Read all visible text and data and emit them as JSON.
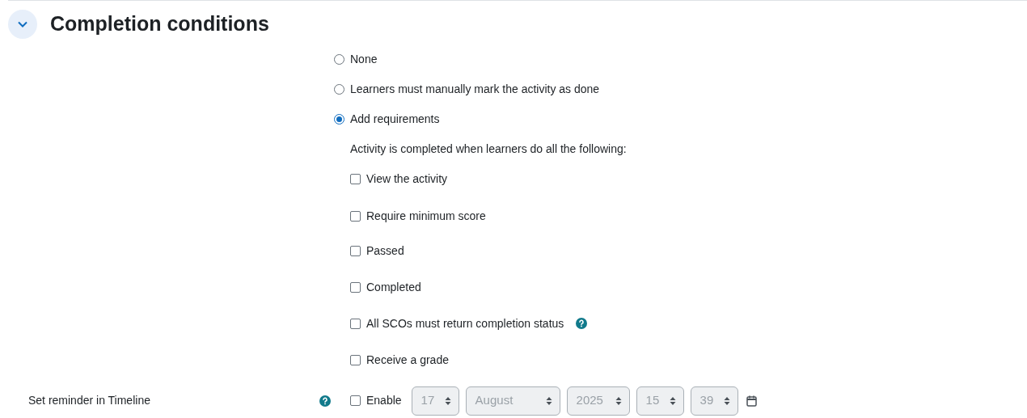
{
  "section": {
    "title": "Completion conditions",
    "expanded": true
  },
  "options": [
    {
      "label": "None",
      "selected": false
    },
    {
      "label": "Learners must manually mark the activity as done",
      "selected": false
    },
    {
      "label": "Add requirements",
      "selected": true
    }
  ],
  "requirements_intro": "Activity is completed when learners do all the following:",
  "requirements": [
    {
      "label": "View the activity",
      "checked": false,
      "help": false
    },
    {
      "label": "Require minimum score",
      "checked": false,
      "help": false
    },
    {
      "label": "Passed",
      "checked": false,
      "help": false
    },
    {
      "label": "Completed",
      "checked": false,
      "help": false
    },
    {
      "label": "All SCOs must return completion status",
      "checked": false,
      "help": true
    },
    {
      "label": "Receive a grade",
      "checked": false,
      "help": false
    }
  ],
  "reminder": {
    "label": "Set reminder in Timeline",
    "enable_label": "Enable",
    "checked": false,
    "disabled": true,
    "fields": [
      {
        "value": "17",
        "kind": "short"
      },
      {
        "value": "August",
        "kind": "wide"
      },
      {
        "value": "2025",
        "kind": "year"
      },
      {
        "value": "15",
        "kind": "short"
      },
      {
        "value": "39",
        "kind": "short"
      }
    ]
  }
}
